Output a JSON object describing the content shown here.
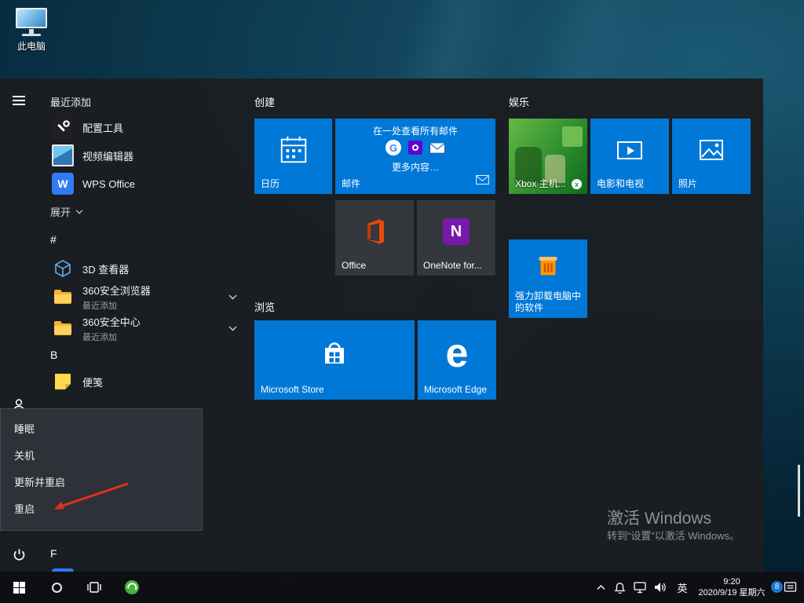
{
  "desktop": {
    "this_pc_label": "此电脑",
    "watermark": {
      "title": "激活 Windows",
      "subtitle": "转到“设置”以激活 Windows。"
    }
  },
  "start": {
    "recent_header": "最近添加",
    "expand_label": "展开",
    "letters": [
      "#",
      "B",
      "F"
    ],
    "apps": [
      {
        "label": "配置工具"
      },
      {
        "label": "视频编辑器"
      },
      {
        "label": "WPS Office",
        "letter": "W"
      },
      {
        "label": "3D 查看器"
      },
      {
        "label": "便笺"
      }
    ],
    "folders": [
      {
        "label": "360安全浏览器",
        "sub": "最近添加"
      },
      {
        "label": "360安全中心",
        "sub": "最近添加"
      }
    ],
    "groups": [
      {
        "name": "创建",
        "tiles": {
          "calendar": "日历",
          "mail": "邮件",
          "mail_promo": "在一处查看所有邮件",
          "mail_more": "更多内容…",
          "mail_icon_g": "G",
          "office": "Office",
          "onenote": "OneNote for...",
          "onenote_letter": "N"
        }
      },
      {
        "name": "浏览",
        "tiles": {
          "store": "Microsoft Store",
          "edge": "Microsoft Edge",
          "edge_letter": "e"
        }
      },
      {
        "name": "娱乐",
        "tiles": {
          "xbox": "Xbox 主机...",
          "xbox_logo": "x",
          "movies": "电影和电视",
          "photos": "照片",
          "uninstall": "强力卸载电脑中的软件"
        }
      }
    ]
  },
  "power_menu": {
    "items": [
      "睡眠",
      "关机",
      "更新并重启",
      "重启"
    ]
  },
  "taskbar": {
    "ime": "英",
    "time": "9:20",
    "date": "2020/9/19 星期六",
    "badge": "8"
  }
}
